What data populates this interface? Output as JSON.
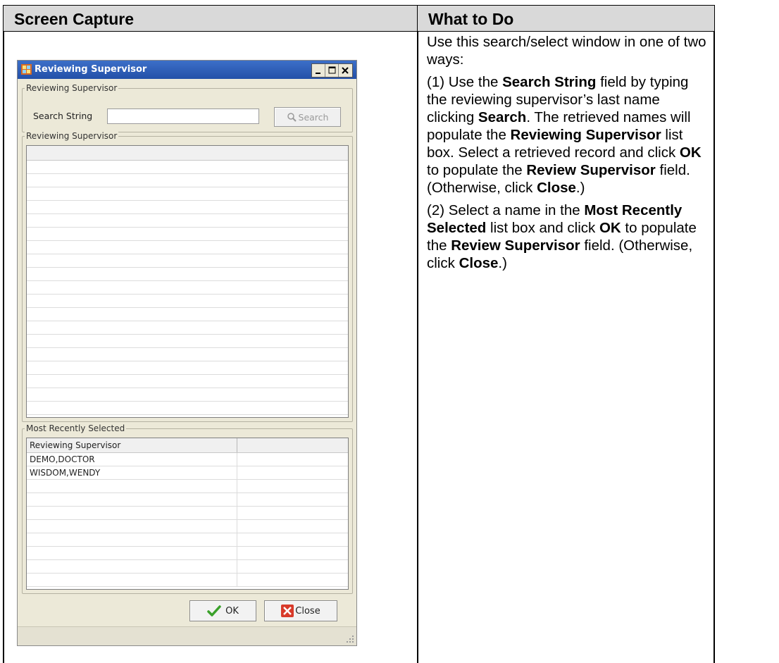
{
  "table": {
    "col1_header": "Screen Capture",
    "col2_header": "What to Do"
  },
  "instructions": {
    "intro": "Use this search/select window in one of two ways:",
    "p1_a": "(1) Use the ",
    "p1_b": "Search String",
    "p1_c": " field by typing the reviewing supervisor’s last name clicking ",
    "p1_d": "Search",
    "p1_e": ". The retrieved names will populate the ",
    "p1_f": "Reviewing Supervisor",
    "p1_g": " list box. Select a retrieved record and click ",
    "p1_h": "OK",
    "p1_i": " to populate the ",
    "p1_j": "Review Supervisor",
    "p1_k": " field. (Otherwise, click ",
    "p1_l": "Close",
    "p1_m": ".)",
    "p2_a": "(2) Select a name in the ",
    "p2_b": "Most Recently Selected",
    "p2_c": " list box and click ",
    "p2_d": "OK",
    "p2_e": " to populate the ",
    "p2_f": "Review Supervisor",
    "p2_g": " field. (Otherwise, click ",
    "p2_h": "Close",
    "p2_i": ".)"
  },
  "dialog": {
    "title": "Reviewing Supervisor",
    "search_group_label": "Reviewing Supervisor",
    "search_label": "Search String",
    "search_value": "",
    "search_button": "Search",
    "results_group_label": "Reviewing Supervisor",
    "recent_group_label": "Most Recently Selected",
    "recent_column": "Reviewing Supervisor",
    "recent_rows": [
      "DEMO,DOCTOR",
      "WISDOM,WENDY"
    ],
    "ok_button": "OK",
    "close_button": "Close"
  },
  "colors": {
    "titlebar": "#2c5cb8",
    "dialog_bg": "#ece9d8",
    "header_shading": "#d9d9d9"
  }
}
